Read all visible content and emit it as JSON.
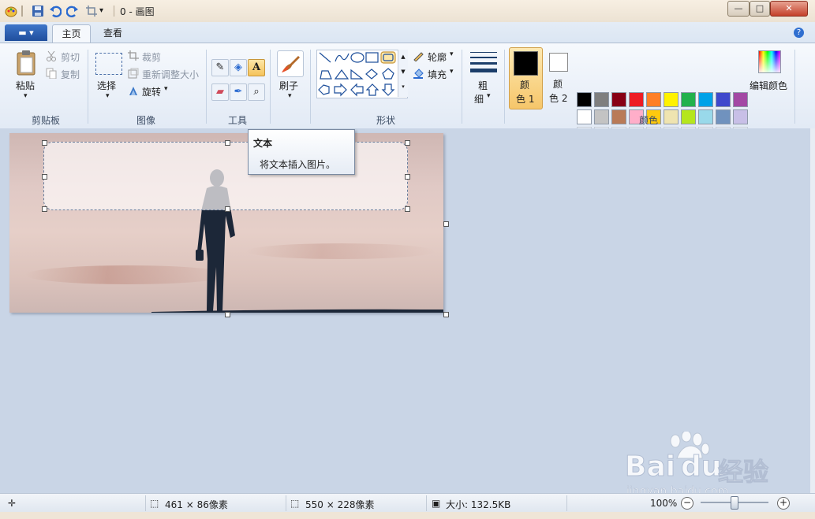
{
  "window": {
    "title": "0 - 画图",
    "minimize_glyph": "—",
    "maximize_glyph": "□",
    "close_glyph": "✕"
  },
  "tabs": {
    "file_glyph": "▬ ▾",
    "home": "主页",
    "view": "查看",
    "help_glyph": "?"
  },
  "ribbon": {
    "clipboard": {
      "paste": "粘贴",
      "cut": "剪切",
      "copy": "复制",
      "group": "剪贴板"
    },
    "image": {
      "select": "选择",
      "crop": "裁剪",
      "resize": "重新调整大小",
      "rotate": "旋转",
      "group": "图像"
    },
    "tools": {
      "group": "工具"
    },
    "brush": {
      "label": "刷子"
    },
    "shapes": {
      "outline": "轮廓",
      "fill": "填充",
      "group": "形状"
    },
    "size": {
      "label_line1": "粗",
      "label_line2": "细"
    },
    "colors": {
      "color1_line1": "颜",
      "color1_line2": "色 1",
      "color2_line1": "颜",
      "color2_line2": "色 2",
      "edit": "编辑颜色",
      "group": "颜色",
      "palette_row1": [
        "#000000",
        "#7f7f7f",
        "#880015",
        "#ed1c24",
        "#ff7f27",
        "#fff200",
        "#22b14c",
        "#00a2e8",
        "#3f48cc",
        "#a349a4"
      ],
      "palette_row2": [
        "#ffffff",
        "#c3c3c3",
        "#b97a57",
        "#ffaec9",
        "#ffc90e",
        "#efe4b0",
        "#b5e61d",
        "#99d9ea",
        "#7092be",
        "#c8bfe7"
      ],
      "color1": "#000000",
      "color2": "#ffffff"
    }
  },
  "tooltip": {
    "title": "文本",
    "body": "将文本插入图片。"
  },
  "status": {
    "selection_size": "461 × 86像素",
    "image_size": "550 × 228像素",
    "file_size": "大小: 132.5KB",
    "zoom": "100%"
  },
  "watermark": {
    "brand": "Bai",
    "brand2": "du",
    "cn": "经验",
    "url": "jingyan.baidu.com"
  }
}
